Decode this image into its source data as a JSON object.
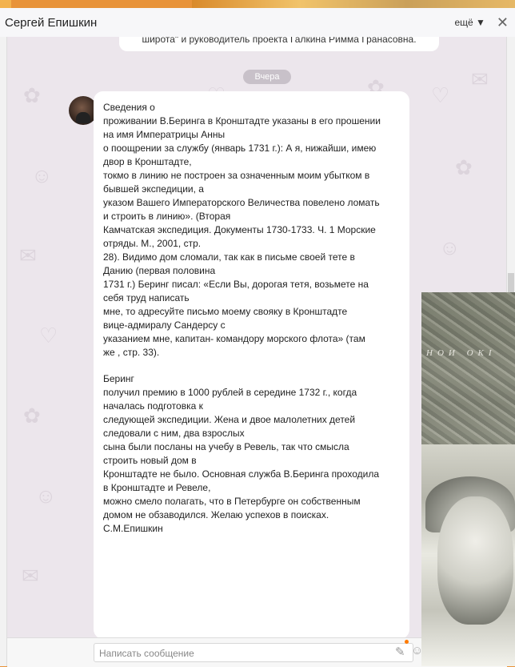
{
  "window": {
    "title": "Сергей Епишкин",
    "more_label": "ещё ▼",
    "close_glyph": "✕"
  },
  "chat": {
    "previous_message_fragment": "широта\" и руководитель проекта Галкина Римма Гранасовна.",
    "date_divider": "Вчера",
    "message_paragraph1": [
      "Сведения о",
      "проживании В.Беринга в Кронштадте указаны в его прошении",
      "на имя Императрицы Анны",
      "о поощрении за службу (январь 1731 г.): А я, нижайши, имею",
      "двор в Кронштадте,",
      "токмо в линию не построен за означенным моим убытком в",
      "бывшей экспедиции, а",
      "указом Вашего Императорского Величества повелено ломать",
      "и строить в линию». (Вторая",
      "Камчатская экспедиция. Документы 1730-1733. Ч. 1 Морские",
      "отряды. М., 2001, стр.",
      "28). Видимо дом сломали, так как в письме своей тете в",
      "Данию (первая половина",
      "1731 г.) Беринг писал: «Если Вы, дорогая тетя, возьмете на",
      "себя труд написать",
      "мне, то адресуйте письмо моему свояку в Кронштадте",
      "вице-адмиралу Сандерсу с",
      "указанием мне, капитан- командору морского флота» (там",
      "же , стр. 33)."
    ],
    "message_paragraph2": [
      "Беринг",
      "получил премию в 1000 рублей в середине 1732 г., когда",
      "началась подготовка к",
      "следующей экспедиции. Жена и двое малолетних детей",
      "следовали с ним, два взрослых",
      "сына были посланы на учебу в Ревель, так что смысла",
      "строить новый дом в",
      "Кронштадте не было. Основная служба В.Беринга проходила",
      "в Кронштадте и Ревеле,",
      "можно смело полагать, что в Петербурге он собственным",
      "домом не обзаводился. Желаю успехов в поисках.",
      "С.М.Епишкин"
    ]
  },
  "input": {
    "placeholder": "Написать сообщение"
  },
  "photo": {
    "map_text": "НОИ  ОКІ"
  },
  "icons": {
    "close": "close-icon",
    "attach": "paperclip-icon",
    "emoji": "emoji-icon",
    "avatar": "avatar"
  },
  "colors": {
    "desktop_orange": "#e8933a",
    "chat_background": "#ece6ec",
    "bubble": "#ffffff",
    "date_chip": "#c8c1c9",
    "notification_dot": "#ff7a00"
  }
}
